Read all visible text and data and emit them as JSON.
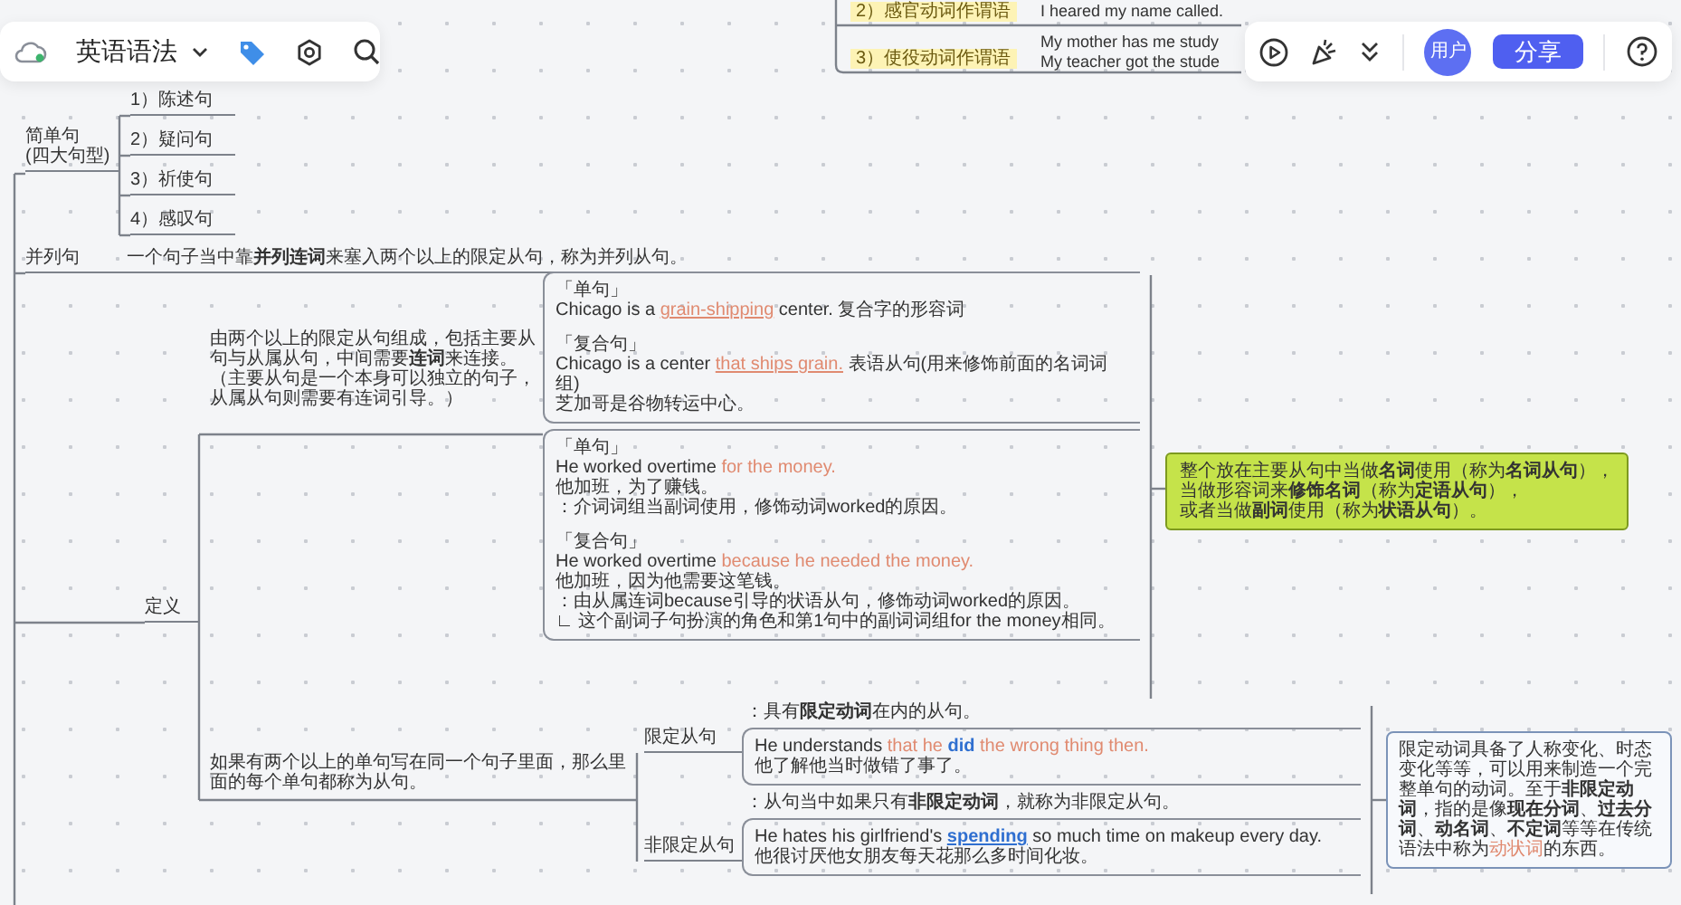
{
  "toolbar_left": {
    "title": "英语语法"
  },
  "toolbar_right": {
    "avatar": "用户",
    "share_button": "分享"
  },
  "top_examples": [
    {
      "label": "2）感官动词作谓语",
      "lines": [
        "I heared my name called."
      ]
    },
    {
      "label": "3）使役动词作谓语",
      "lines": [
        "My mother has me study",
        "My teacher got the stude"
      ]
    }
  ],
  "simple_sentence": {
    "label_lines": [
      "简单句",
      "(四大句型)"
    ],
    "children": [
      {
        "text": "1）陈述句"
      },
      {
        "text": "2）疑问句"
      },
      {
        "text": "3）祈使句"
      },
      {
        "text": "4）感叹句"
      }
    ]
  },
  "compound_sentence": {
    "label": "并列句",
    "definition": "一个句子当中靠**并列连词**来塞入两个以上的限定从句，称为并列从句。"
  },
  "complex_sentence": {
    "label": "定义",
    "composition": {
      "lines": [
        "由两个以上的限定从句组成，包括主要从句与从属从句，中间需要**连词**来连接。",
        "（主要从句是一个本身可以独立的句子，从属从句则需要有连词引导。）"
      ],
      "examples": [
        {
          "groups": [
            [
              "「单句」",
              [
                {
                  "text": "Chicago is a ",
                  "kind": "plain"
                },
                {
                  "text": "grain-shipping",
                  "kind": "accent_underlined"
                },
                {
                  "text": " center. 复合字的形容词",
                  "kind": "plain"
                }
              ]
            ],
            [
              "「复合句」",
              [
                {
                  "text": "Chicago is a center ",
                  "kind": "plain"
                },
                {
                  "text": "that ships grain.",
                  "kind": "accent_underlined"
                },
                {
                  "text": " 表语从句(用来修饰前面的名词词组)",
                  "kind": "plain"
                }
              ],
              "芝加哥是谷物转运中心。"
            ]
          ]
        },
        {
          "groups": [
            [
              "「单句」",
              [
                {
                  "text": "He worked overtime ",
                  "kind": "plain"
                },
                {
                  "text": "for the money.",
                  "kind": "accent"
                }
              ],
              "他加班，为了赚钱。",
              "：介词词组当副词使用，修饰动词worked的原因。"
            ],
            [
              "「复合句」",
              [
                {
                  "text": "He worked overtime ",
                  "kind": "plain"
                },
                {
                  "text": "because he needed the money.",
                  "kind": "accent"
                }
              ],
              "他加班，因为他需要这笔钱。",
              "：由从属连词because引导的状语从句，修饰动词worked的原因。",
              "∟ 这个副词子句扮演的角色和第1句中的副词词组for the money相同。"
            ]
          ]
        }
      ],
      "note": [
        "整个放在主要从句中当做**名词**使用（称为**名词从句**），",
        "当做形容词来**修饰名词**（称为**定语从句**），",
        "或者当做**副词**使用（称为**状语从句**）。"
      ]
    },
    "clause": {
      "text": "如果有两个以上的单句写在同一个句子里面，那么里面的每个单句都称为从句。",
      "types": [
        {
          "label": "限定从句",
          "caption": "：具有**限定动词**在内的从句。",
          "example": [
            [
              {
                "text": "He understands ",
                "kind": "plain"
              },
              {
                "text": "that he ",
                "kind": "accent"
              },
              {
                "text": "did",
                "kind": "key"
              },
              {
                "text": " the wrong thing then.",
                "kind": "accent"
              }
            ],
            "他了解他当时做错了事了。"
          ]
        },
        {
          "label": "非限定从句",
          "caption": "：从句当中如果只有**非限定动词**，就称为非限定从句。",
          "example": [
            [
              {
                "text": "He hates his girlfriend's ",
                "kind": "plain"
              },
              {
                "text": "spending",
                "kind": "key_underlined"
              },
              {
                "text": " so much time on makeup every day.",
                "kind": "plain"
              }
            ],
            "他很讨厌他女朋友每天花那么多时间化妆。"
          ]
        }
      ],
      "note": [
        {
          "text": "限定动词具备了人称变化、时态变化等等，可以用来制造一个完整单句的动词。至于**非限定动词**，指的是像**现在分词**、**过去分词**、**动名词**、**不定词**等等在传统语法中称为",
          "kind": "plain"
        },
        {
          "text": "动状词",
          "kind": "accent"
        },
        {
          "text": "的东西。",
          "kind": "plain"
        }
      ]
    }
  }
}
